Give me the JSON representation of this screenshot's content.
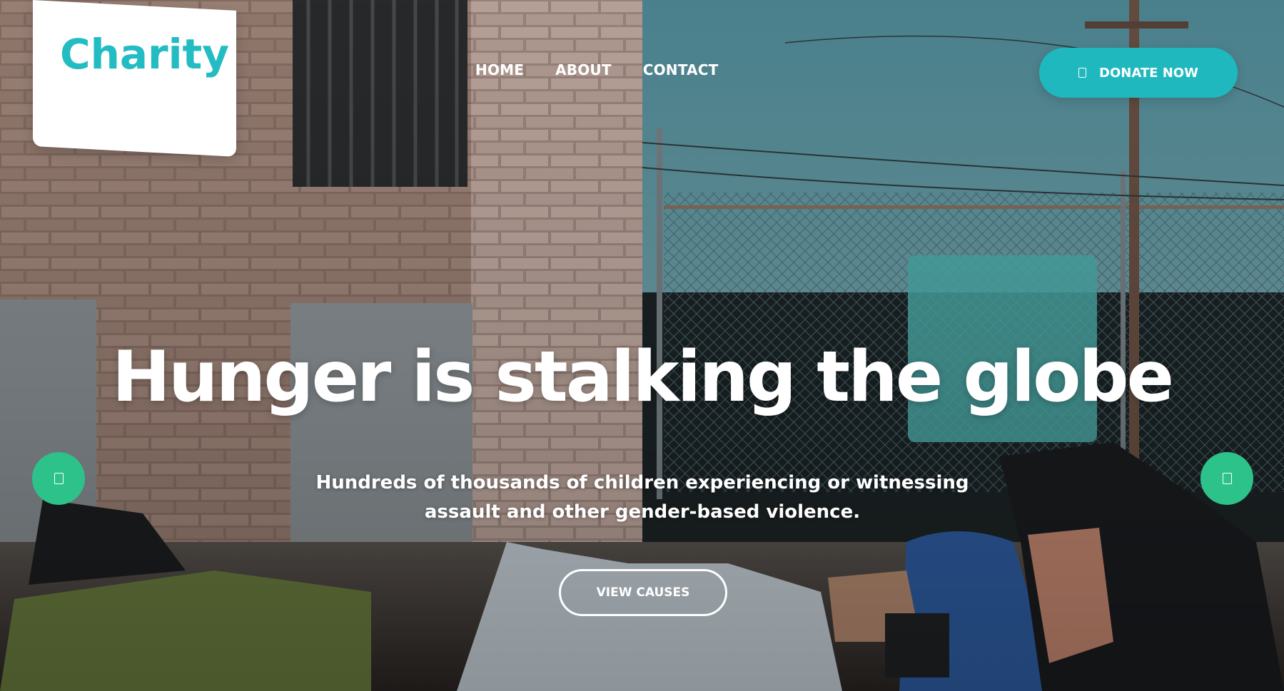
{
  "brand": {
    "logo_text": "Charity",
    "accent_color": "#22bcc2",
    "donate_color": "#1fb8be",
    "arrow_color": "#2ec28b"
  },
  "nav": {
    "items": [
      {
        "label": "HOME"
      },
      {
        "label": "ABOUT"
      },
      {
        "label": "CONTACT"
      }
    ]
  },
  "header": {
    "donate_label": "DONATE NOW",
    "donate_icon": "donate-icon"
  },
  "hero": {
    "headline": "Hunger is stalking the globe",
    "subtext": "Hundreds of thousands of children experiencing or witnessing assault and other gender-based violence.",
    "cta_label": "VIEW CAUSES",
    "prev_icon": "arrow-left-icon",
    "next_icon": "arrow-right-icon"
  }
}
